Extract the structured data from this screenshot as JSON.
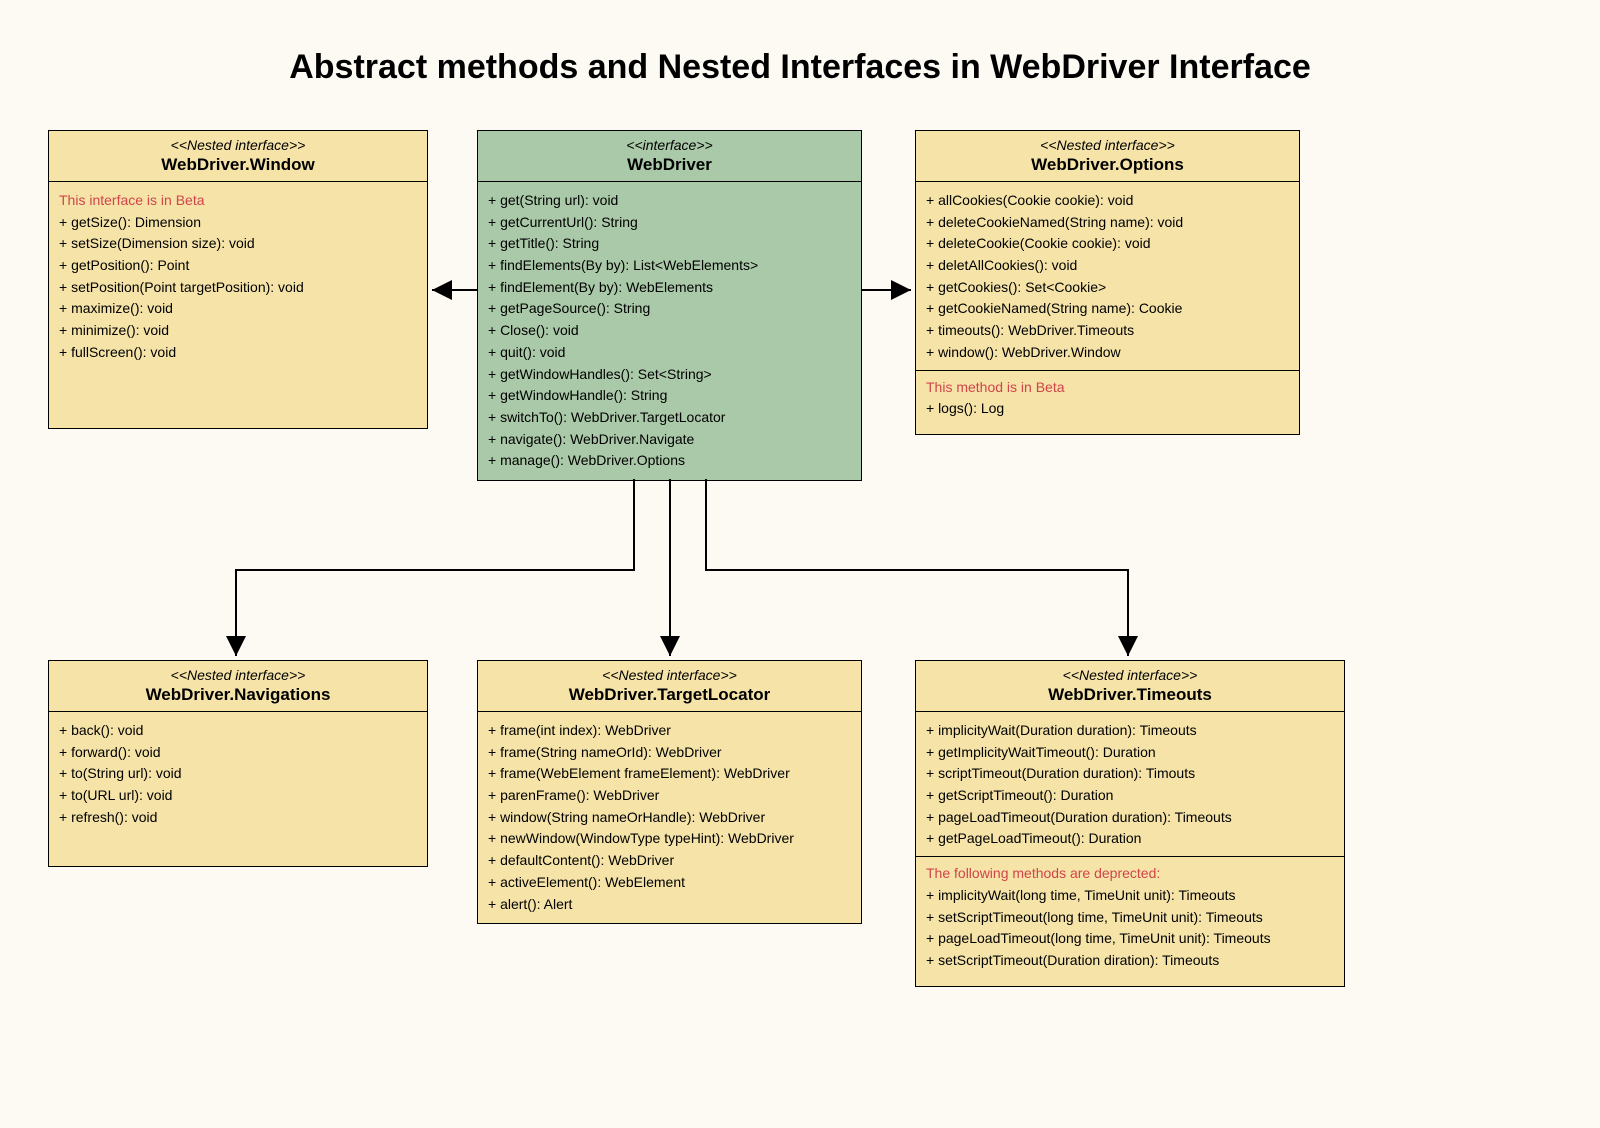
{
  "title": "Abstract methods and Nested Interfaces in WebDriver Interface",
  "boxes": {
    "window": {
      "stereo": "<<Nested interface>>",
      "name": "WebDriver.Window",
      "warn": "This interface is in Beta",
      "m0": "+ getSize(): Dimension",
      "m1": "+ setSize(Dimension size): void",
      "m2": "+ getPosition(): Point",
      "m3": "+ setPosition(Point targetPosition): void",
      "m4": "+ maximize(): void",
      "m5": "+ minimize(): void",
      "m6": "+ fullScreen(): void"
    },
    "webdriver": {
      "stereo": "<<interface>>",
      "name": "WebDriver",
      "m0": "+ get(String url): void",
      "m1": "+ getCurrentUrl(): String",
      "m2": "+ getTitle(): String",
      "m3": "+ findElements(By by): List<WebElements>",
      "m4": "+ findElement(By by): WebElements",
      "m5": "+ getPageSource(): String",
      "m6": "+ Close(): void",
      "m7": "+ quit(): void",
      "m8": "+ getWindowHandles(): Set<String>",
      "m9": "+ getWindowHandle(): String",
      "m10": "+ switchTo(): WebDriver.TargetLocator",
      "m11": "+ navigate(): WebDriver.Navigate",
      "m12": "+ manage(): WebDriver.Options"
    },
    "options": {
      "stereo": "<<Nested interface>>",
      "name": "WebDriver.Options",
      "m0": "+ allCookies(Cookie cookie): void",
      "m1": "+ deleteCookieNamed(String name): void",
      "m2": "+ deleteCookie(Cookie cookie): void",
      "m3": "+ deletAllCookies(): void",
      "m4": "+ getCookies(): Set<Cookie>",
      "m5": "+ getCookieNamed(String name): Cookie",
      "m6": "+ timeouts(): WebDriver.Timeouts",
      "m7": "+ window(): WebDriver.Window",
      "warn": "This method is in Beta",
      "m8": "+ logs(): Log"
    },
    "nav": {
      "stereo": "<<Nested interface>>",
      "name": "WebDriver.Navigations",
      "m0": "+ back(): void",
      "m1": "+ forward(): void",
      "m2": "+ to(String url): void",
      "m3": "+ to(URL url): void",
      "m4": "+ refresh(): void"
    },
    "target": {
      "stereo": "<<Nested interface>>",
      "name": "WebDriver.TargetLocator",
      "m0": "+ frame(int index): WebDriver",
      "m1": "+ frame(String nameOrId): WebDriver",
      "m2": "+ frame(WebElement frameElement): WebDriver",
      "m3": "+ parenFrame(): WebDriver",
      "m4": "+ window(String nameOrHandle): WebDriver",
      "m5": "+ newWindow(WindowType typeHint): WebDriver",
      "m6": "+ defaultContent(): WebDriver",
      "m7": "+ activeElement(): WebElement",
      "m8": "+ alert(): Alert"
    },
    "timeouts": {
      "stereo": "<<Nested interface>>",
      "name": "WebDriver.Timeouts",
      "m0": "+ implicityWait(Duration duration): Timeouts",
      "m1": "+ getImplicityWaitTimeout(): Duration",
      "m2": "+ scriptTimeout(Duration duration): Timouts",
      "m3": "+ getScriptTimeout(): Duration",
      "m4": "+ pageLoadTimeout(Duration duration): Timeouts",
      "m5": "+ getPageLoadTimeout(): Duration",
      "warn": "The following methods are deprected:",
      "m6": "+ implicityWait(long time, TimeUnit unit): Timeouts",
      "m7": "+ setScriptTimeout(long time, TimeUnit unit): Timeouts",
      "m8": "+ pageLoadTimeout(long time, TimeUnit unit): Timeouts",
      "m9": "+ setScriptTimeout(Duration diration): Timeouts"
    }
  }
}
